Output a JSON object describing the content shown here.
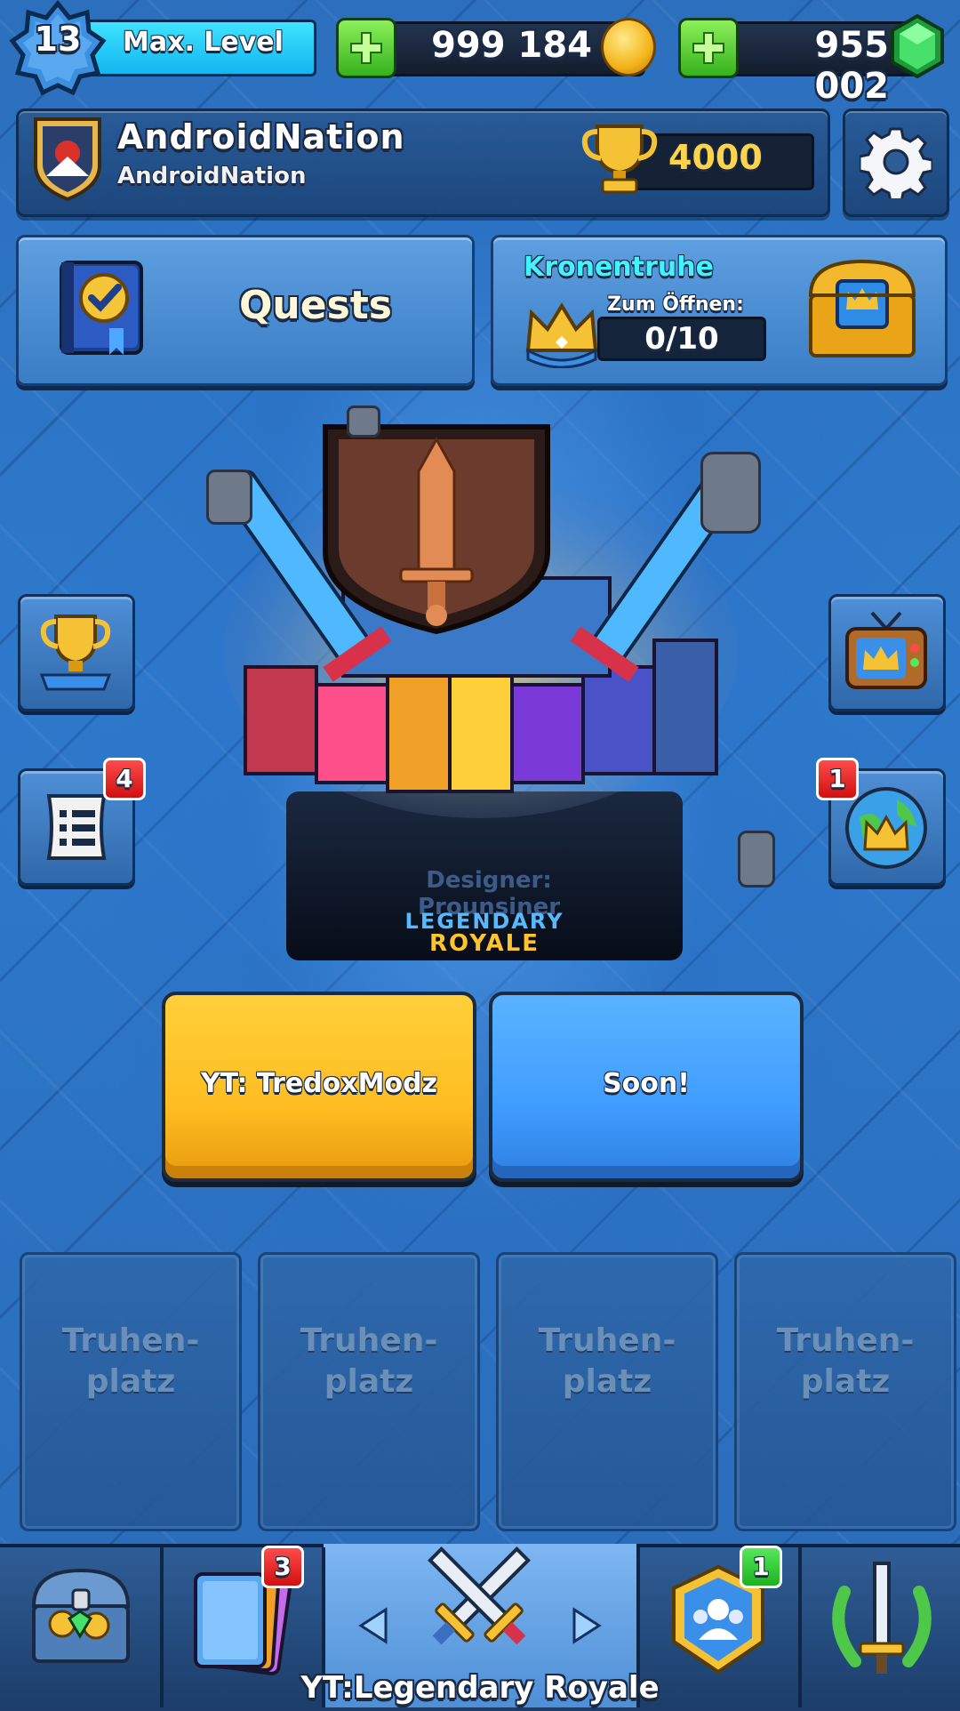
{
  "top_bar": {
    "level": "13",
    "level_label": "Max. Level",
    "gold": "999 184",
    "gems": "955 002"
  },
  "player": {
    "name": "AndroidNation",
    "clan": "AndroidNation",
    "trophies": "4000"
  },
  "quests": {
    "label": "Quests"
  },
  "crown_chest": {
    "title": "Kronentruhe",
    "subtitle": "Zum Öffnen:",
    "progress": "0/10"
  },
  "side_badges": {
    "news": "4",
    "clan_wars": "1"
  },
  "arena": {
    "designer_label": "Designer:",
    "designer_name": "Prounsiner",
    "name_line1": "LEGENDARY",
    "name_line2": "ROYALE"
  },
  "buttons": {
    "left": "YT: TredoxModz",
    "right": "Soon!"
  },
  "chest_slots": [
    {
      "label": "Truhen-\nplatz"
    },
    {
      "label": "Truhen-\nplatz"
    },
    {
      "label": "Truhen-\nplatz"
    },
    {
      "label": "Truhen-\nplatz"
    }
  ],
  "bottom_nav": {
    "cards_badge": "3",
    "clan_badge": "1",
    "active_label": "YT:Legendary Royale"
  },
  "colors": {
    "level_bar": "#13b6ef",
    "plus_green": "#36b21d",
    "coin_gold": "#f3b41a",
    "gem_green": "#2fd05a",
    "trophy_text": "#ffd34a",
    "crown_title": "#44f2ff",
    "yellow_button": "#ffbe22",
    "blue_button": "#3f9dff",
    "badge_red": "#d01010"
  },
  "icons": [
    "level-star-icon",
    "plus-icon",
    "coin-icon",
    "gem-icon",
    "clan-badge-icon",
    "trophy-icon",
    "gear-icon",
    "quest-book-icon",
    "crown-icon",
    "crown-chest-icon",
    "trophy-road-icon",
    "news-scroll-icon",
    "tv-royale-icon",
    "clan-war-globe-icon",
    "shop-chest-icon",
    "cards-icon",
    "crossed-swords-icon",
    "clan-shield-icon",
    "tournament-sword-icon",
    "arrow-left-icon",
    "arrow-right-icon"
  ]
}
